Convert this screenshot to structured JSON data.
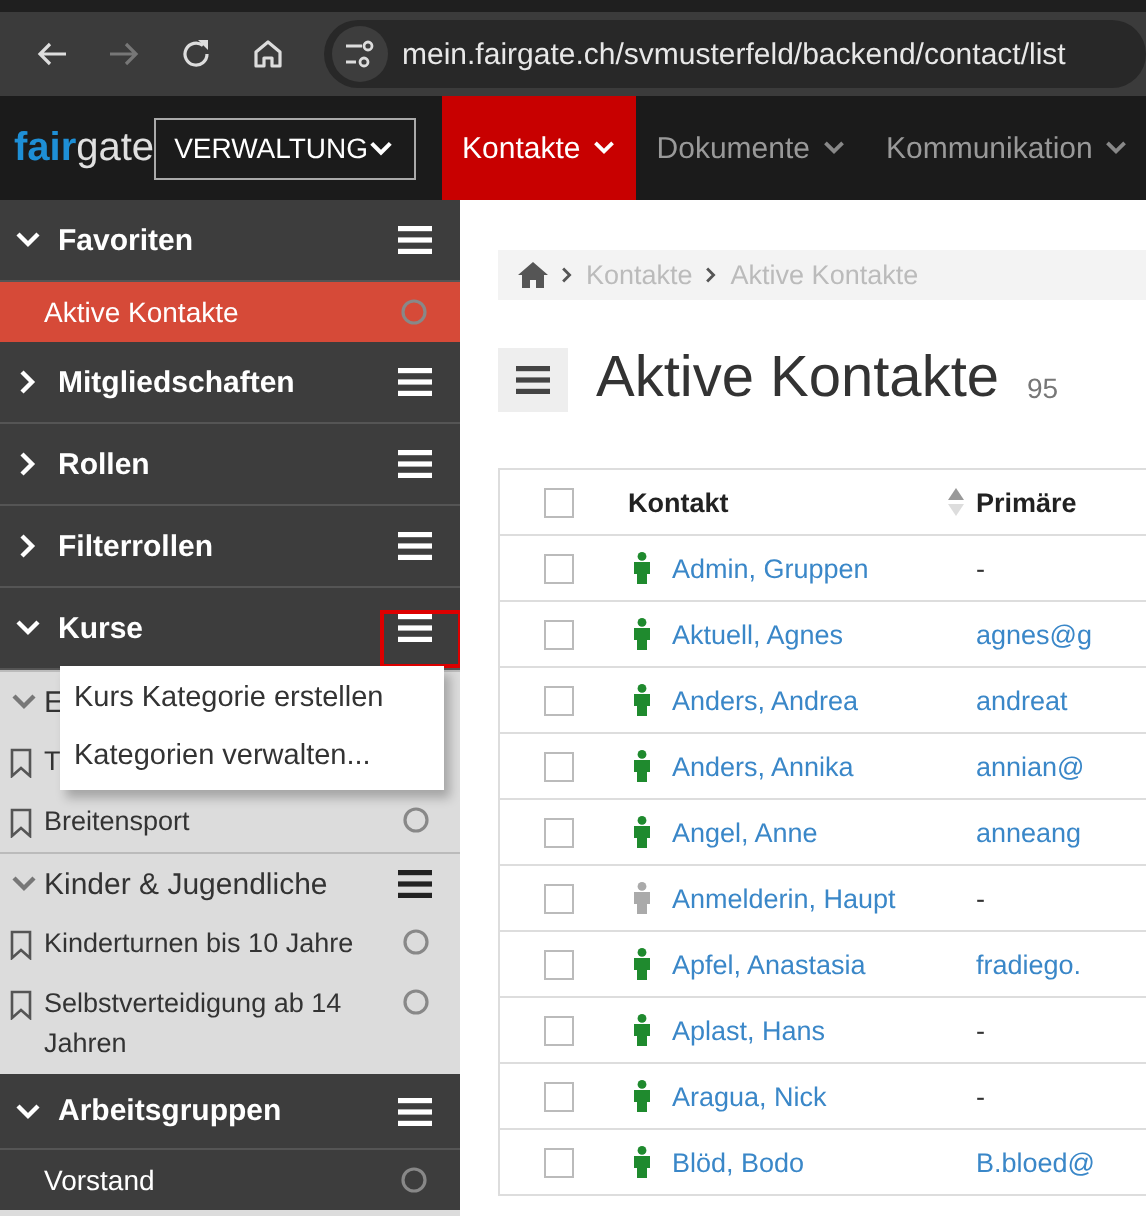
{
  "browser": {
    "url": "mein.fairgate.ch/svmusterfeld/backend/contact/list",
    "forward_disabled": true
  },
  "app_header": {
    "logo_accent": "fair",
    "logo_rest": "gate",
    "module": "VERWALTUNG",
    "nav": [
      {
        "label": "Kontakte",
        "selected": true
      },
      {
        "label": "Dokumente",
        "selected": false
      },
      {
        "label": "Kommunikation",
        "selected": false
      }
    ]
  },
  "sidebar": {
    "sections": [
      {
        "title": "Favoriten",
        "expanded": true,
        "items": [
          {
            "label": "Aktive Kontakte",
            "selected": true
          }
        ]
      },
      {
        "title": "Mitgliedschaften",
        "expanded": false
      },
      {
        "title": "Rollen",
        "expanded": false
      },
      {
        "title": "Filterrollen",
        "expanded": false
      },
      {
        "title": "Kurse",
        "expanded": true,
        "highlighted": true,
        "categories": [
          {
            "title": "E",
            "expanded": true,
            "items": [
              {
                "label": "T",
                "selected": false
              },
              {
                "label": "Breitensport",
                "selected": false
              }
            ]
          },
          {
            "title": "Kinder & Jugendliche",
            "expanded": true,
            "items": [
              {
                "label": "Kinderturnen bis 10 Jahre",
                "selected": false
              },
              {
                "label": "Selbstverteidigung ab 14 Jahren",
                "selected": false
              }
            ]
          }
        ]
      },
      {
        "title": "Arbeitsgruppen",
        "expanded": true,
        "items": [
          {
            "label": "Vorstand",
            "selected": false
          }
        ]
      }
    ],
    "context_menu": [
      "Kurs Kategorie erstellen",
      "Kategorien verwalten..."
    ]
  },
  "main": {
    "breadcrumb": [
      "Kontakte",
      "Aktive Kontakte"
    ],
    "title": "Aktive Kontakte",
    "count": "95",
    "table": {
      "columns": [
        "Kontakt",
        "Primäre"
      ],
      "all_checked": false,
      "rows": [
        {
          "name": "Admin, Gruppen",
          "email": "-",
          "active": true,
          "checked": false
        },
        {
          "name": "Aktuell, Agnes",
          "email": "agnes@g",
          "active": true,
          "checked": false
        },
        {
          "name": "Anders, Andrea",
          "email": "andreat",
          "active": true,
          "checked": false
        },
        {
          "name": "Anders, Annika",
          "email": "annian@",
          "active": true,
          "checked": false
        },
        {
          "name": "Angel, Anne",
          "email": "anneang",
          "active": true,
          "checked": false
        },
        {
          "name": "Anmelderin, Haupt",
          "email": "-",
          "active": false,
          "checked": false
        },
        {
          "name": "Apfel, Anastasia",
          "email": "fradiego.",
          "active": true,
          "checked": false
        },
        {
          "name": "Aplast, Hans",
          "email": "-",
          "active": true,
          "checked": false
        },
        {
          "name": "Aragua, Nick",
          "email": "-",
          "active": true,
          "checked": false
        },
        {
          "name": "Blöd, Bodo",
          "email": "B.bloed@",
          "active": true,
          "checked": false
        }
      ]
    }
  }
}
